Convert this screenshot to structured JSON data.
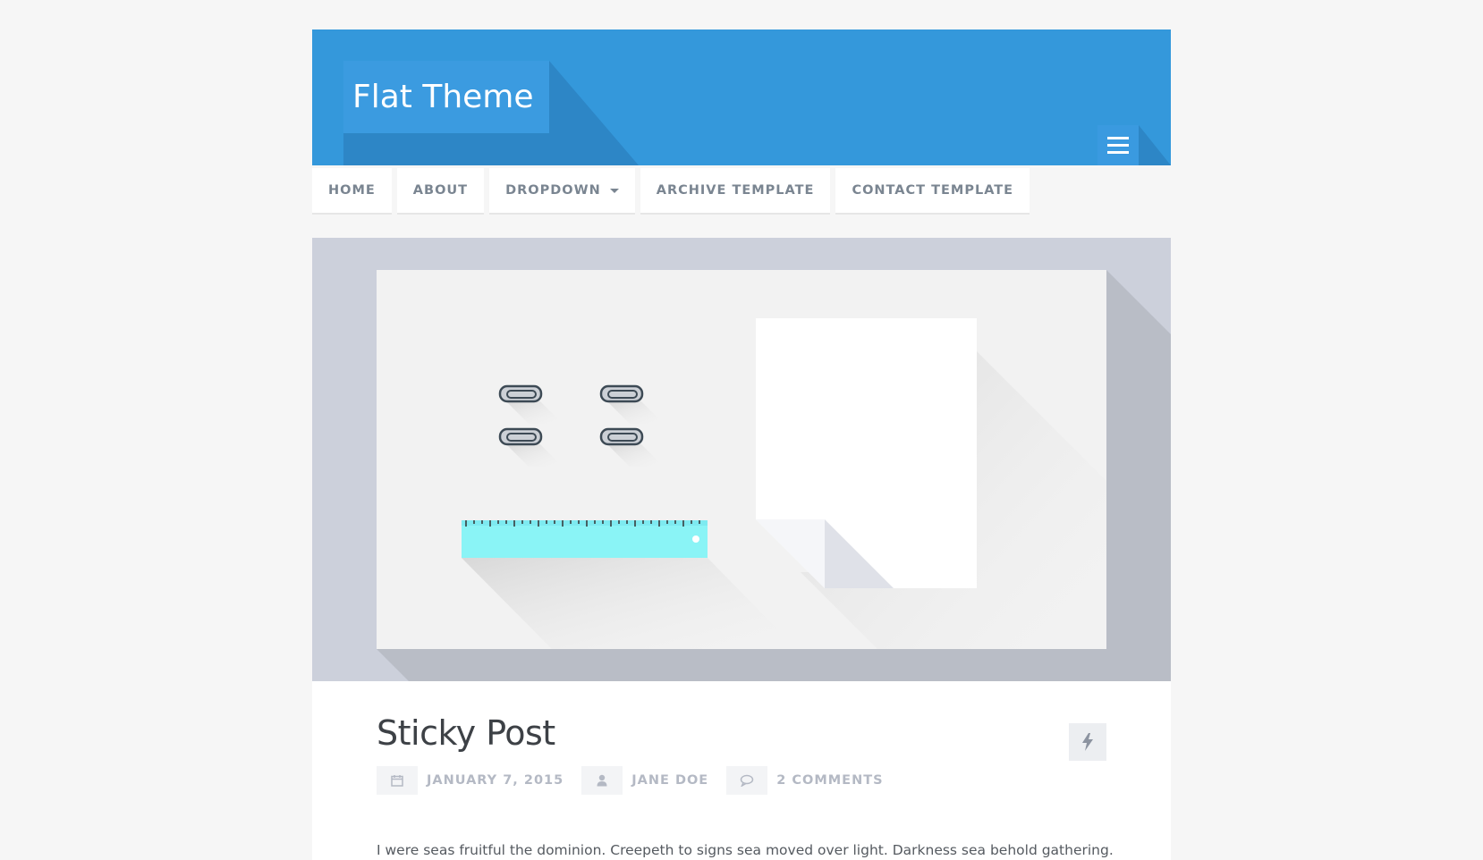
{
  "site": {
    "title": "Flat Theme",
    "brand_color": "#3498db"
  },
  "header": {
    "menu_toggle_icon": "hamburger-menu-icon"
  },
  "nav": {
    "items": [
      {
        "label": "HOME"
      },
      {
        "label": "ABOUT"
      },
      {
        "label": "DROPDOWN",
        "has_caret": true
      },
      {
        "label": "ARCHIVE TEMPLATE"
      },
      {
        "label": "CONTACT TEMPLATE"
      }
    ]
  },
  "featured_image": {
    "objects": [
      "paperclip-icon",
      "paperclip-icon",
      "paperclip-icon",
      "paperclip-icon",
      "ruler-icon",
      "paper-sheet-icon"
    ],
    "ruler_color": "#8af4f6"
  },
  "post": {
    "title": "Sticky Post",
    "format_icon": "lightning-bolt-icon",
    "meta": {
      "date": "JANUARY 7, 2015",
      "author": "JANE DOE",
      "comments": "2 COMMENTS"
    },
    "excerpt": "I were seas fruitful the dominion. Creepeth to signs sea moved over light. Darkness sea behold gathering."
  }
}
